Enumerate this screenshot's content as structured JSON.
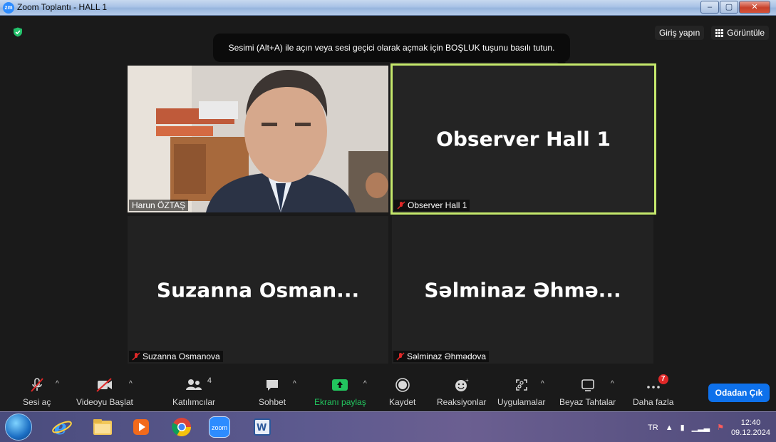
{
  "window": {
    "title": "Zoom Toplantı - HALL 1",
    "app_icon_text": "zm",
    "buttons": [
      "minimize",
      "maximize",
      "close"
    ]
  },
  "header": {
    "sign_in_label": "Giriş yapın",
    "view_label": "Görüntüle",
    "encryption_icon": "shield-check-icon"
  },
  "tooltip": {
    "text": "Sesimi (Alt+A) ile açın veya sesi geçici olarak açmak için BOŞLUK tuşunu basılı tutun."
  },
  "participants": [
    {
      "name": "Harun ÖZTAŞ",
      "video": true,
      "muted": false
    },
    {
      "name": "Observer Hall 1",
      "display_name": "Observer Hall 1",
      "video": false,
      "muted": true,
      "active_speaker": true
    },
    {
      "name": "Suzanna Osmanova",
      "display_name": "Suzanna  Osman...",
      "video": false,
      "muted": true
    },
    {
      "name": "Səlminaz Əhmədova",
      "display_name": "Səlminaz  Əhmə...",
      "video": false,
      "muted": true
    }
  ],
  "toolbar": {
    "audio": "Sesi aç",
    "video": "Videoyu Başlat",
    "participants": "Katılımcılar",
    "participants_count": "4",
    "chat": "Sohbet",
    "share": "Ekranı paylaş",
    "record": "Kaydet",
    "reactions": "Reaksiyonlar",
    "apps": "Uygulamalar",
    "whiteboards": "Beyaz Tahtalar",
    "more": "Daha fazla",
    "more_badge": "7",
    "leave": "Odadan Çık"
  },
  "taskbar": {
    "apps": [
      "start-orb",
      "internet-explorer",
      "file-explorer",
      "media-player",
      "chrome",
      "zoom",
      "word"
    ],
    "zoom_label": "zoom",
    "language": "TR",
    "time": "12:40",
    "date": "09.12.2024"
  },
  "colors": {
    "active_speaker_border": "#c5e86c",
    "leave_button": "#0e71eb",
    "share_green": "#22c55e",
    "muted_red": "#e02828"
  }
}
